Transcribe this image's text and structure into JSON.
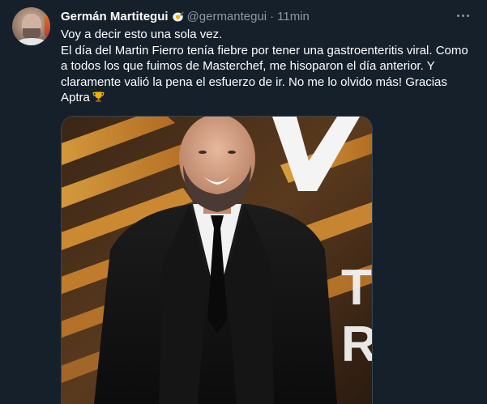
{
  "author": {
    "display_name": "Germán Martitegui",
    "handle": "@germantegui",
    "separator": "·",
    "timestamp": "11min",
    "badge_icon": "cooking-egg-icon"
  },
  "tweet": {
    "lines": [
      "Voy a decir esto una sola vez.",
      "El día del Martin Fierro tenía fiebre por tener una gastroenteritis viral. Como a todos los que fuimos de Masterchef, me hisoparon el día anterior. Y claramente valió la pena el esfuerzo de ir. No me lo olvido más! Gracias Aptra"
    ],
    "trailing_icon": "trophy-icon"
  },
  "media": {
    "backdrop_letters_1": "TÍ",
    "backdrop_letters_2": "RO"
  },
  "colors": {
    "background": "#15202b",
    "primary_text": "#ffffff",
    "secondary_text": "#8b98a5",
    "border": "#38444d"
  }
}
